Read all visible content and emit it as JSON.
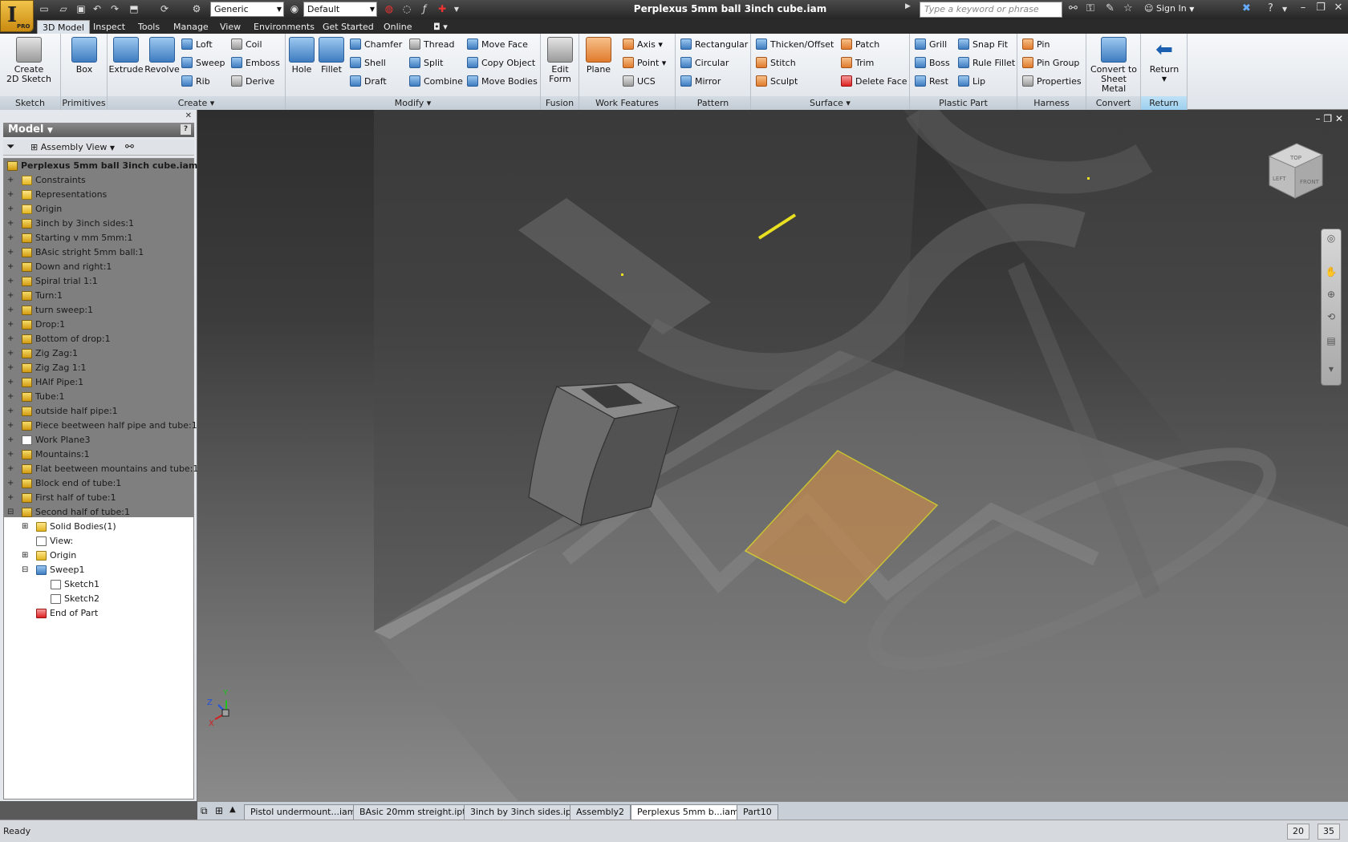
{
  "app": {
    "badge": "PRO",
    "document_title": "Perplexus 5mm ball 3inch cube.iam"
  },
  "toolbar": {
    "material_combo": "Generic",
    "appearance_combo": "Default",
    "search_placeholder": "Type a keyword or phrase",
    "sign_in": "Sign In"
  },
  "tabs": [
    "3D Model",
    "Inspect",
    "Tools",
    "Manage",
    "View",
    "Environments",
    "Get Started",
    "Online"
  ],
  "ribbon": {
    "panels": {
      "sketch": "Sketch",
      "primitives": "Primitives",
      "create": "Create",
      "modify": "Modify",
      "fusion": "Fusion",
      "work_features": "Work Features",
      "pattern": "Pattern",
      "surface": "Surface",
      "plastic_part": "Plastic Part",
      "harness": "Harness",
      "convert": "Convert",
      "return": "Return"
    },
    "create_2d_sketch": [
      "Create",
      "2D Sketch"
    ],
    "box": "Box",
    "extrude": "Extrude",
    "revolve": "Revolve",
    "loft": "Loft",
    "sweep": "Sweep",
    "rib": "Rib",
    "coil": "Coil",
    "emboss": "Emboss",
    "derive": "Derive",
    "hole": "Hole",
    "fillet": "Fillet",
    "chamfer": "Chamfer",
    "shell": "Shell",
    "draft": "Draft",
    "thread": "Thread",
    "split": "Split",
    "combine": "Combine",
    "move_face": "Move Face",
    "copy_object": "Copy Object",
    "move_bodies": "Move Bodies",
    "edit_form": [
      "Edit",
      "Form"
    ],
    "plane": "Plane",
    "axis": "Axis",
    "point": "Point",
    "ucs": "UCS",
    "rectangular": "Rectangular",
    "circular": "Circular",
    "mirror": "Mirror",
    "thicken_offset": "Thicken/Offset",
    "stitch": "Stitch",
    "sculpt": "Sculpt",
    "patch": "Patch",
    "trim": "Trim",
    "delete_face": "Delete Face",
    "grill": "Grill",
    "boss": "Boss",
    "rest": "Rest",
    "snap_fit": "Snap Fit",
    "rule_fillet": "Rule Fillet",
    "lip": "Lip",
    "pin": "Pin",
    "pin_group": "Pin Group",
    "properties": "Properties",
    "convert_sheet_metal": [
      "Convert to",
      "Sheet Metal"
    ],
    "return": "Return"
  },
  "browser": {
    "header": "Model",
    "view_combo": "Assembly View",
    "root": "Perplexus 5mm ball 3inch cube.iam",
    "items": [
      "Constraints",
      "Representations",
      "Origin",
      "3inch by 3inch sides:1",
      "Starting v mm 5mm:1",
      "BAsic stright 5mm ball:1",
      "Down and right:1",
      "Spiral trial 1:1",
      "Turn:1",
      "turn sweep:1",
      "Drop:1",
      "Bottom of drop:1",
      "Zig Zag:1",
      "Zig Zag 1:1",
      "HAlf Pipe:1",
      "Tube:1",
      "outside half pipe:1",
      "Piece beetween half pipe and tube:1",
      "Work Plane3",
      "Mountains:1",
      "Flat beetween mountains and tube:1",
      "Block end of tube:1",
      "First half of tube:1"
    ],
    "active_part": "Second half of tube:1",
    "children": [
      "Solid Bodies(1)",
      "View:",
      "Origin",
      "Sweep1",
      "Sketch1",
      "Sketch2",
      "End of Part"
    ]
  },
  "doc_tabs": [
    "Pistol undermount...iam",
    "BAsic 20mm streight.ipt",
    "3inch by 3inch sides.ipt",
    "Assembly2",
    "Perplexus 5mm b...iam",
    "Part10"
  ],
  "viewcube": {
    "top": "TOP",
    "left": "LEFT",
    "front": "FRONT"
  },
  "axes": {
    "x": "X",
    "y": "Y",
    "z": "Z"
  },
  "status": {
    "text": "Ready",
    "num1": "20",
    "num2": "35"
  }
}
